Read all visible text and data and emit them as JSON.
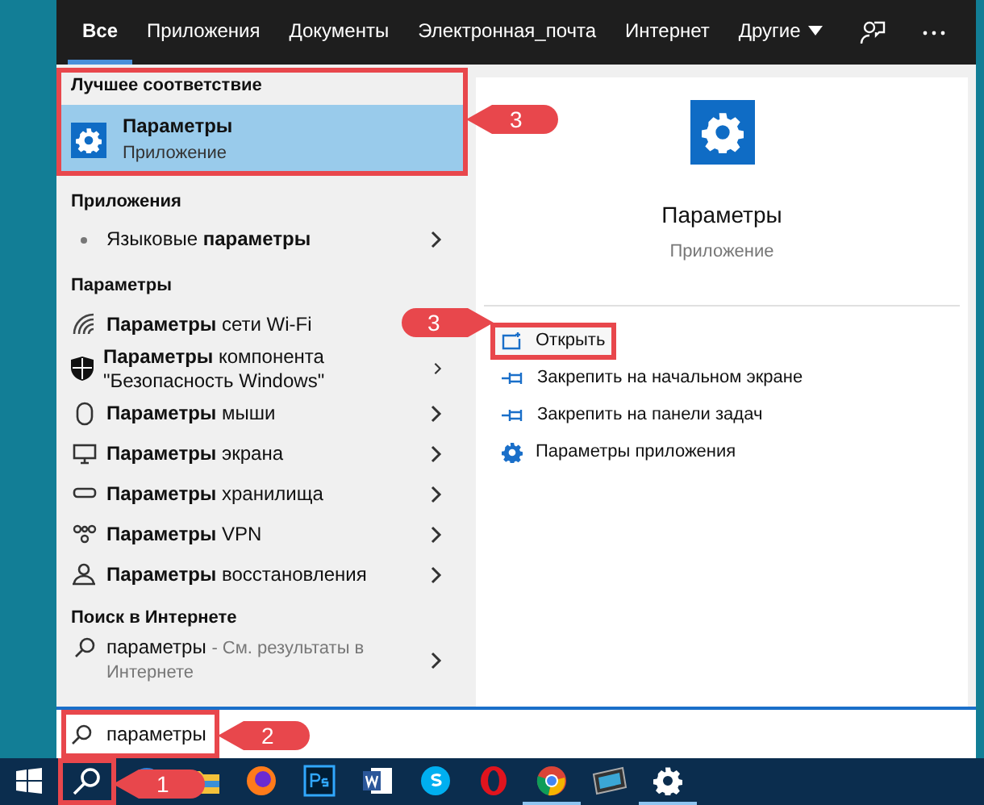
{
  "tabs": [
    {
      "label": "Все",
      "selected": true,
      "dropdown": false
    },
    {
      "label": "Приложения",
      "selected": false,
      "dropdown": false
    },
    {
      "label": "Документы",
      "selected": false,
      "dropdown": false
    },
    {
      "label": "Электронная_почта",
      "selected": false,
      "dropdown": false
    },
    {
      "label": "Интернет",
      "selected": false,
      "dropdown": false
    },
    {
      "label": "Другие",
      "selected": false,
      "dropdown": true
    }
  ],
  "best_match": {
    "header": "Лучшее соответствие",
    "title": "Параметры",
    "subtitle": "Приложение",
    "selected": true,
    "highlighted": true
  },
  "groups": [
    {
      "header": "Приложения",
      "items": [
        {
          "label": "Языковые **параметры**",
          "chevron": true
        }
      ]
    },
    {
      "header": "Параметры",
      "items": [
        {
          "label": "**Параметры** сети Wi-Fi",
          "chevron": false
        },
        {
          "label": "**Параметры** компонента \"Безопасность Windows\"",
          "chevron": true
        },
        {
          "label": "**Параметры** мыши",
          "chevron": true
        },
        {
          "label": "**Параметры** экрана",
          "chevron": true
        },
        {
          "label": "**Параметры** хранилища",
          "chevron": true
        },
        {
          "label": "**Параметры** VPN",
          "chevron": true
        },
        {
          "label": "**Параметры** восстановления",
          "chevron": true
        }
      ]
    }
  ],
  "web": {
    "header": "Поиск в Интернете",
    "query": "параметры",
    "hint": "- См. результаты в Интернете"
  },
  "preview": {
    "title": "Параметры",
    "subtitle": "Приложение",
    "actions": [
      {
        "label": "Открыть",
        "highlighted": true
      },
      {
        "label": "Закрепить на начальном экране",
        "highlighted": false
      },
      {
        "label": "Закрепить на панели задач",
        "highlighted": false
      },
      {
        "label": "Параметры приложения",
        "highlighted": false
      }
    ]
  },
  "search_box": {
    "value": "параметры",
    "highlighted": true
  },
  "taskbar": [
    {
      "running": false,
      "highlighted": false
    },
    {
      "running": false,
      "highlighted": true
    },
    {
      "running": false,
      "highlighted": false
    },
    {
      "running": false,
      "highlighted": false
    },
    {
      "running": false,
      "highlighted": false
    },
    {
      "running": false,
      "highlighted": false
    },
    {
      "running": false,
      "highlighted": false
    },
    {
      "running": false,
      "highlighted": false
    },
    {
      "running": false,
      "highlighted": false
    },
    {
      "running": true,
      "highlighted": false
    },
    {
      "running": false,
      "highlighted": false
    },
    {
      "running": true,
      "highlighted": false
    }
  ],
  "callouts": [
    {
      "number": "3"
    },
    {
      "number": "3"
    },
    {
      "number": "2"
    },
    {
      "number": "1"
    }
  ]
}
